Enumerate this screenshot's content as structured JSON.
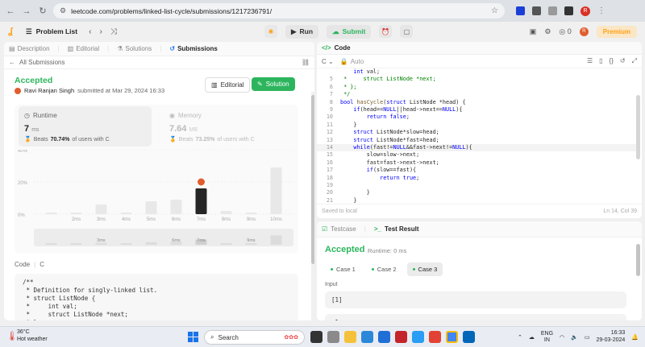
{
  "browser": {
    "url": "leetcode.com/problems/linked-list-cycle/submissions/1217236791/",
    "profile_initial": "R"
  },
  "nav": {
    "problem_list": "Problem List",
    "run": "Run",
    "submit": "Submit",
    "coins": "0",
    "avatar_initial": "R",
    "premium": "Premium"
  },
  "left_tabs": {
    "description": "Description",
    "editorial": "Editorial",
    "solutions": "Solutions",
    "submissions": "Submissions"
  },
  "submission": {
    "back_label": "All Submissions",
    "status": "Accepted",
    "author": "Ravi Ranjan Singh",
    "submitted_at": "submitted at Mar 29, 2024 16:33",
    "editorial_btn": "Editorial",
    "solution_btn": "Solution",
    "runtime_label": "Runtime",
    "runtime_value": "7",
    "runtime_unit": "ms",
    "runtime_beats_pre": "Beats",
    "runtime_beats_pct": "70.74%",
    "runtime_beats_post": "of users with C",
    "memory_label": "Memory",
    "memory_value": "7.64",
    "memory_unit": "MB",
    "memory_beats_pre": "Beats",
    "memory_beats_pct": "73.25%",
    "memory_beats_post": "of users with C",
    "code_label": "Code",
    "code_lang": "C",
    "code_preview": "/**\n * Definition for singly-linked list.\n * struct ListNode {\n *     int val;\n *     struct ListNode *next;\n * };"
  },
  "chart_data": {
    "type": "bar",
    "categories": [
      "",
      "2ms",
      "3ms",
      "4ms",
      "5ms",
      "6ms",
      "7ms",
      "8ms",
      "9ms",
      "10ms"
    ],
    "values": [
      1,
      1,
      6,
      1,
      8,
      9,
      16,
      2,
      1,
      29
    ],
    "highlight_category": "7ms",
    "y_ticks": [
      "40%",
      "20%",
      "0%"
    ],
    "ylim": [
      0,
      40
    ],
    "mini_labels": [
      "3ms",
      "6ms",
      "7ms",
      "9ms"
    ]
  },
  "editor": {
    "tab_label": "Code",
    "language": "C",
    "mode": "Auto",
    "saved": "Saved to local",
    "cursor": "Ln 14, Col 39",
    "lines": [
      {
        "n": "",
        "t": "    int val;"
      },
      {
        "n": "5",
        "t": " *     struct ListNode *next;"
      },
      {
        "n": "6",
        "t": " * };"
      },
      {
        "n": "7",
        "t": " */"
      },
      {
        "n": "8",
        "t": "bool hasCycle(struct ListNode *head) {"
      },
      {
        "n": "9",
        "t": "    if(head==NULL||head->next==NULL){"
      },
      {
        "n": "10",
        "t": "        return false;"
      },
      {
        "n": "11",
        "t": "    }"
      },
      {
        "n": "12",
        "t": "    struct ListNode*slow=head;"
      },
      {
        "n": "13",
        "t": "    struct ListNode*fast=head;"
      },
      {
        "n": "14",
        "t": "    while(fast!=NULL&&fast->next!=NULL){"
      },
      {
        "n": "15",
        "t": "        slow=slow->next;"
      },
      {
        "n": "16",
        "t": "        fast=fast->next->next;"
      },
      {
        "n": "17",
        "t": "        if(slow==fast){"
      },
      {
        "n": "18",
        "t": "            return true;"
      },
      {
        "n": "19",
        "t": ""
      },
      {
        "n": "20",
        "t": "        }"
      },
      {
        "n": "21",
        "t": "    }"
      }
    ]
  },
  "test": {
    "testcase_tab": "Testcase",
    "result_tab": "Test Result",
    "status": "Accepted",
    "runtime": "Runtime: 0 ms",
    "cases": [
      "Case 1",
      "Case 2",
      "Case 3"
    ],
    "input_label": "Input",
    "input_value": "[1]",
    "input_value2": "-1"
  },
  "taskbar": {
    "temp": "36°C",
    "weather": "Hot weather",
    "search": "Search",
    "lang1": "ENG",
    "lang2": "IN",
    "time": "16:33",
    "date": "29-03-2024"
  }
}
